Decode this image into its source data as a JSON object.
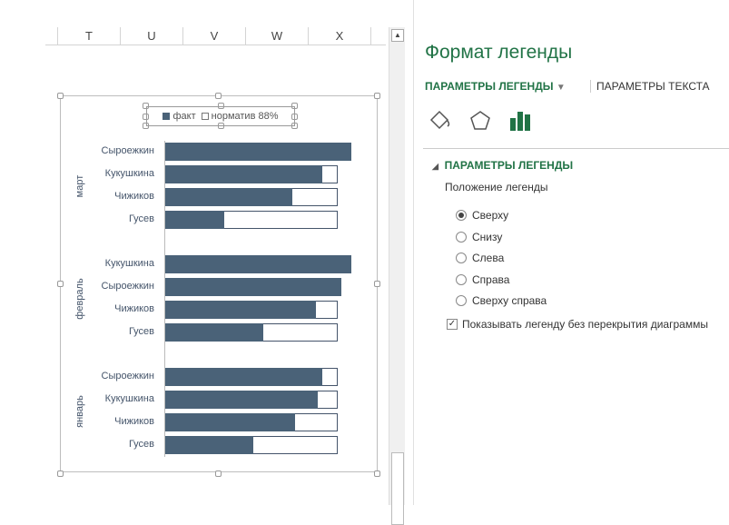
{
  "columns": [
    "T",
    "U",
    "V",
    "W",
    "X"
  ],
  "chart_data": {
    "type": "bar",
    "legend": [
      {
        "label": "факт",
        "color": "#4a6278"
      },
      {
        "label": "норматив 88%",
        "color": "#ffffff"
      }
    ],
    "legend_position": "top",
    "norm_percent": 88,
    "xlim": [
      0,
      100
    ],
    "groups": [
      {
        "name": "март",
        "categories": [
          "Сыроежкин",
          "Кукушкина",
          "Чижиков",
          "Гусев"
        ],
        "fact": [
          95,
          80,
          65,
          30
        ]
      },
      {
        "name": "февраль",
        "categories": [
          "Кукушкина",
          "Сыроежкин",
          "Чижиков",
          "Гусев"
        ],
        "fact": [
          95,
          90,
          77,
          50
        ]
      },
      {
        "name": "январь",
        "categories": [
          "Сыроежкин",
          "Кукушкина",
          "Чижиков",
          "Гусев"
        ],
        "fact": [
          80,
          78,
          66,
          45
        ]
      }
    ]
  },
  "pane": {
    "title": "Формат легенды",
    "tab_active": "ПАРАМЕТРЫ ЛЕГЕНДЫ",
    "tab_other": "ПАРАМЕТРЫ ТЕКСТА",
    "section": "ПАРАМЕТРЫ ЛЕГЕНДЫ",
    "position_label": "Положение легенды",
    "options": [
      "Сверху",
      "Снизу",
      "Слева",
      "Справа",
      "Сверху справа"
    ],
    "selected": 0,
    "checkbox_label": "Показывать легенду без перекрытия диаграммы",
    "checkbox_checked": true,
    "accent": "#217346"
  }
}
